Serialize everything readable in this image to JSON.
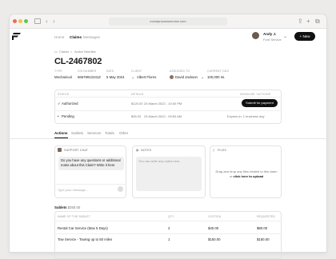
{
  "browser": {
    "url": "eventprocessservice.com",
    "colors": {
      "close": "#ee6a5f",
      "minimize": "#f5be4f",
      "maximize": "#62c554"
    }
  },
  "header": {
    "nav": [
      "Home",
      "Claims",
      "Messages"
    ],
    "user_name": "Andy J.",
    "user_company": "Ford Service",
    "new_label": "New"
  },
  "breadcrumb": {
    "root": "Claims",
    "separator": ">",
    "current": "Active Needles"
  },
  "claim": {
    "id": "CL-2467802",
    "meta": [
      {
        "label": "TYPE",
        "value": "Mechanical"
      },
      {
        "label": "VIN NUMBER",
        "value": "66678812341Z"
      },
      {
        "label": "DATE",
        "value": "5 May 2024"
      },
      {
        "label": "CLIENT",
        "value": "Albert Flores"
      },
      {
        "label": "ASSIGNED TO",
        "value": "David Jackson"
      },
      {
        "label": "CURRENT ODO",
        "value": "100,000 mi."
      }
    ]
  },
  "status_card": {
    "col_status": "STATUS",
    "col_details": "DETAILS",
    "col_deadline": "DEADLINE / ACTIONS",
    "rows": [
      {
        "status": "Authorized",
        "amount": "$120.00",
        "date": "24 March 2022 - 10:00 PM",
        "action": "Submit for payment"
      },
      {
        "status": "Pending",
        "amount": "$95.20",
        "date": "24 March 2022 - 09:50 AM",
        "expiry": "Expires in: 1 business day"
      }
    ]
  },
  "tabs": [
    "Actions",
    "Sublets",
    "Services",
    "Totals",
    "Other"
  ],
  "support_chat": {
    "title": "SUPPORT CHAT",
    "message": "Do you have any questions or additional notes about this Claim? Write it here",
    "placeholder": "Type your message..."
  },
  "notes": {
    "title": "NOTES",
    "placeholder": "You can write any notes here."
  },
  "files": {
    "title": "FILES",
    "text": "Drag and drop any files related to this claim or",
    "link": "click here to upload"
  },
  "sublets": {
    "title": "Sublets",
    "total": "$250.00",
    "headers": [
      "NAME OF THE SUBLET",
      "QTY",
      "COST/EA",
      "REQUESTED"
    ],
    "rows": [
      {
        "name": "Rental Car Service (Max 5 Days)",
        "qty": "2",
        "cost": "$40.00",
        "requested": "$80.00"
      },
      {
        "name": "Tow Service - Towing up to 50 miles",
        "qty": "1",
        "cost": "$150.00",
        "requested": "$150.00"
      }
    ]
  }
}
